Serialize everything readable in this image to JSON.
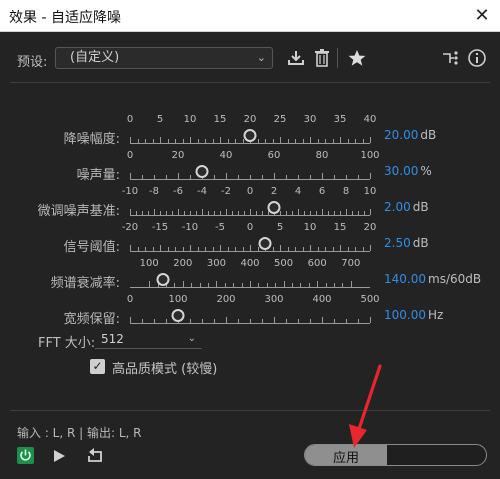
{
  "window": {
    "title": "效果 - 自适应降噪",
    "close_symbol": "✕"
  },
  "toolbar": {
    "preset_label": "预设:",
    "preset_value": "(自定义)",
    "icons": [
      "download-preset-icon",
      "trash-icon",
      "star-icon",
      "signal-routing-icon",
      "info-icon"
    ]
  },
  "sliders": [
    {
      "label": "降噪幅度:",
      "ticks": [
        "0",
        "5",
        "10",
        "15",
        "20",
        "25",
        "30",
        "35",
        "40"
      ],
      "min": 0,
      "max": 40,
      "value": 20,
      "value_text": "20.00",
      "unit": "dB"
    },
    {
      "label": "噪声量:",
      "ticks": [
        "0",
        "20",
        "40",
        "60",
        "80",
        "100"
      ],
      "min": 0,
      "max": 100,
      "value": 30,
      "value_text": "30.00",
      "unit": "%"
    },
    {
      "label": "微调噪声基准:",
      "ticks": [
        "-10",
        "-8",
        "-6",
        "-4",
        "-2",
        "0",
        "2",
        "4",
        "6",
        "8",
        "10"
      ],
      "min": -10,
      "max": 10,
      "value": 2,
      "value_text": "2.00",
      "unit": "dB"
    },
    {
      "label": "信号阈值:",
      "ticks": [
        "-20",
        "-15",
        "-10",
        "-5",
        "0",
        "5",
        "10",
        "15",
        "20"
      ],
      "min": -20,
      "max": 20,
      "value": 2.5,
      "value_text": "2.50",
      "unit": "dB"
    },
    {
      "label": "频谱衰减率:",
      "ticks": [
        "100",
        "200",
        "300",
        "400",
        "500",
        "600",
        "700"
      ],
      "min": 100,
      "max": 700,
      "value": 140,
      "value_text": "140.00",
      "unit": "ms/60dB",
      "offset": 0.08,
      "span": 0.84
    },
    {
      "label": "宽频保留:",
      "ticks": [
        "0",
        "100",
        "200",
        "300",
        "400",
        "500"
      ],
      "min": 0,
      "max": 500,
      "value": 100,
      "value_text": "100.00",
      "unit": "Hz"
    }
  ],
  "fft": {
    "label": "FFT 大小:",
    "value": "512"
  },
  "high_quality": {
    "label": "高品质模式 (较慢)",
    "checked": true,
    "check_symbol": "✓"
  },
  "io_text": "输入 : L, R | 输出: L, R",
  "apply_label": "应用",
  "colors": {
    "accent_blue": "#2f8ee8",
    "power_green": "#1e8f4a",
    "arrow_red": "#e8262d"
  }
}
